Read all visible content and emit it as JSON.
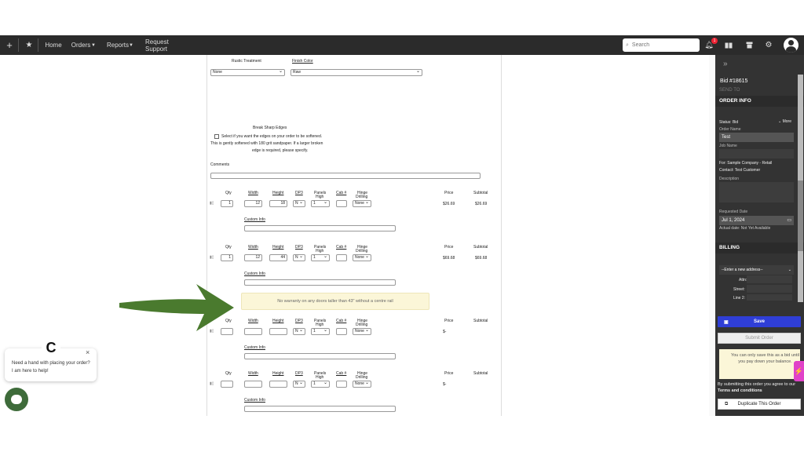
{
  "topbar": {
    "nav": [
      "Home",
      "Orders",
      "Reports",
      "Request Support"
    ],
    "search_placeholder": "Search",
    "notification_count": "1"
  },
  "form": {
    "rustic_label": "Rustic Treatment",
    "rustic_value": "None",
    "finish_label": "Finish Color",
    "finish_value": "Raw",
    "break_title": "Break Sharp Edges",
    "break_line1": "Select if you want the edges on your order to be softened.",
    "break_line2": "This is gently softened with 180 grit sandpaper. If a larger broken",
    "break_line3": "edge is required, please specify.",
    "comments_label": "Comments",
    "headers": {
      "qty": "Qty",
      "width": "Width",
      "height": "Height",
      "dp3": "DP3",
      "panels_high_1": "Panels",
      "panels_high_2": "High",
      "cab": "Cab #",
      "hinge_1": "Hinge",
      "hinge_2": "Drilling",
      "price": "Price",
      "subtotal": "Subtotal"
    },
    "custom_info": "Custom Info",
    "rows": [
      {
        "qty": "1",
        "width": "12",
        "height": "18",
        "dp3": "N",
        "panels": "1",
        "cab": "",
        "hinge": "None",
        "price": "$26.69",
        "subtotal": "$26.69"
      },
      {
        "qty": "1",
        "width": "12",
        "height": "44",
        "dp3": "N",
        "panels": "1",
        "cab": "",
        "hinge": "None",
        "price": "$69.68",
        "subtotal": "$69.68"
      },
      {
        "qty": "",
        "width": "",
        "height": "",
        "dp3": "N",
        "panels": "1",
        "cab": "",
        "hinge": "None",
        "price": "$-",
        "subtotal": ""
      },
      {
        "qty": "",
        "width": "",
        "height": "",
        "dp3": "N",
        "panels": "1",
        "cab": "",
        "hinge": "None",
        "price": "$-",
        "subtotal": ""
      }
    ],
    "warning": "No warranty on any doors taller than 43\" without a centre rail"
  },
  "chat": {
    "message": "Need a hand with placing your order? I am here to help!",
    "logo_letter": "C"
  },
  "panel": {
    "bid": "Bid #18615",
    "send_to": "SEND TO",
    "order_info": "ORDER INFO",
    "status": "Status: Bid",
    "more": "More",
    "order_name_label": "Order Name",
    "order_name": "Test",
    "job_name_label": "Job Name",
    "for": "For: Sample Company - Retail",
    "contact": "Contact: Test Customer",
    "description_label": "Description",
    "requested_date_label": "Requested Date",
    "requested_date": "Jul 1, 2024",
    "actual_date": "Actual date: Not Yet Available",
    "billing": "BILLING",
    "address_select": "--Enter a new address--",
    "attn": "Attn:",
    "street": "Street:",
    "line2": "Line 2:",
    "save": "Save",
    "submit": "Submit Order",
    "save_warning": "You can only save this as a bid until you pay down your balance.",
    "terms_text": "By submitting this order you agree to our",
    "terms_link": "Terms and conditions",
    "duplicate": "Duplicate This Order"
  },
  "colors": {
    "topbar": "#2b2b2b",
    "warning_bg": "#fbf6d8",
    "save_button": "#2f3ed6",
    "arrow": "#4a7a2e",
    "chat_button": "#3e6b3a"
  }
}
